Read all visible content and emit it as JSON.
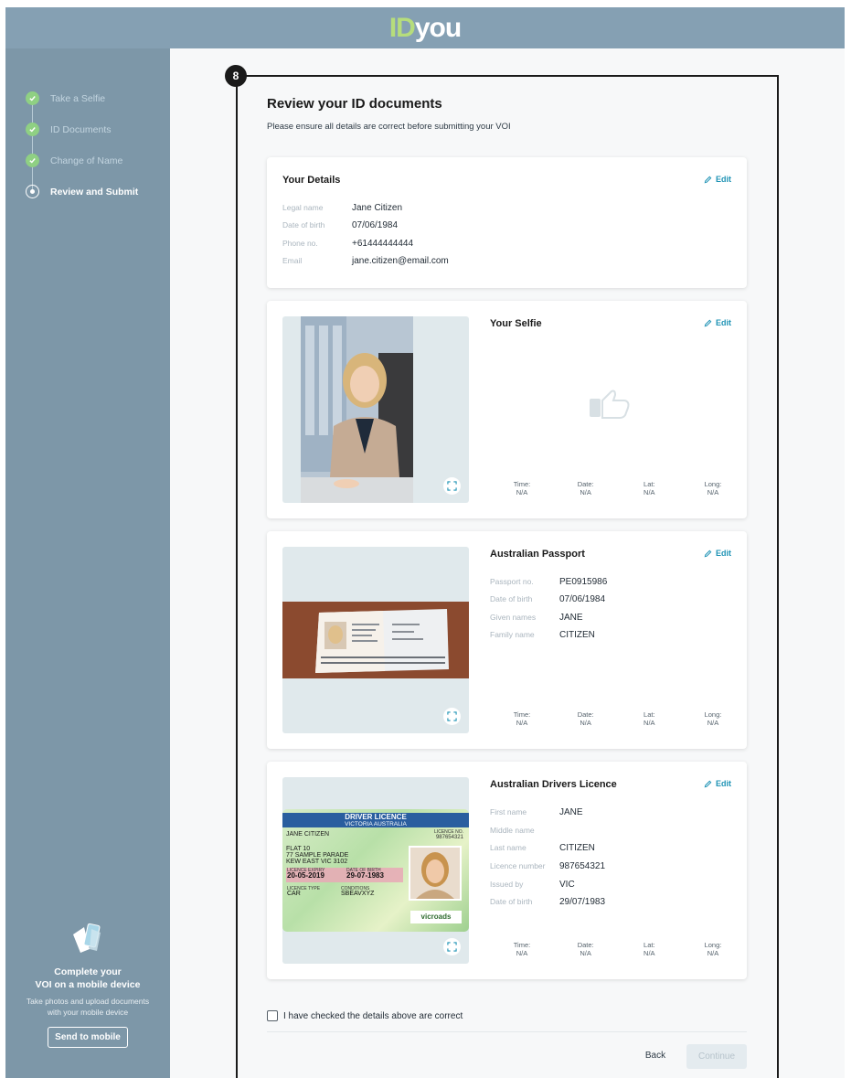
{
  "header": {
    "logo_id": "ID",
    "logo_you": "you"
  },
  "sidebar": {
    "steps": [
      {
        "label": "Take a Selfie",
        "status": "done"
      },
      {
        "label": "ID Documents",
        "status": "done"
      },
      {
        "label": "Change of Name",
        "status": "done"
      },
      {
        "label": "Review and Submit",
        "status": "active"
      }
    ],
    "mobile": {
      "title_line1": "Complete your",
      "title_line2": "VOI on a mobile device",
      "description": "Take photos and upload documents with your mobile device",
      "button": "Send to mobile"
    }
  },
  "main": {
    "badge": "8",
    "title": "Review your ID documents",
    "subtitle": "Please ensure all details are correct before submitting your VOI",
    "edit_label": "Edit",
    "details": {
      "title": "Your Details",
      "rows": [
        {
          "label": "Legal name",
          "value": "Jane Citizen"
        },
        {
          "label": "Date of birth",
          "value": "07/06/1984"
        },
        {
          "label": "Phone no.",
          "value": "+61444444444"
        },
        {
          "label": "Email",
          "value": "jane.citizen@email.com"
        }
      ]
    },
    "meta_labels": [
      "Time:",
      "Date:",
      "Lat:",
      "Long:"
    ],
    "meta_value": "N/A",
    "selfie": {
      "title": "Your Selfie"
    },
    "passport": {
      "title": "Australian Passport",
      "rows": [
        {
          "label": "Passport no.",
          "value": "PE0915986"
        },
        {
          "label": "Date of birth",
          "value": "07/06/1984"
        },
        {
          "label": "Given names",
          "value": "JANE"
        },
        {
          "label": "Family name",
          "value": "CITIZEN"
        }
      ]
    },
    "licence": {
      "title": "Australian Drivers Licence",
      "rows": [
        {
          "label": "First name",
          "value": "JANE"
        },
        {
          "label": "Middle name",
          "value": ""
        },
        {
          "label": "Last name",
          "value": "CITIZEN"
        },
        {
          "label": "Licence number",
          "value": "987654321"
        },
        {
          "label": "Issued by",
          "value": "VIC"
        },
        {
          "label": "Date of birth",
          "value": "29/07/1983"
        }
      ],
      "card_text": {
        "heading": "DRIVER LICENCE",
        "subheading": "VICTORIA AUSTRALIA",
        "name": "JANE CITIZEN",
        "licence_no_label": "LICENCE NO.",
        "licence_no": "987654321",
        "address1": "FLAT 10",
        "address2": "77 SAMPLE PARADE",
        "address3": "KEW EAST VIC 3102",
        "expiry_label": "LICENCE EXPIRY",
        "expiry": "20-05-2019",
        "dob_label": "DATE OF BIRTH",
        "dob": "29-07-1983",
        "type_label": "LICENCE TYPE",
        "type": "CAR",
        "conditions_label": "CONDITIONS",
        "conditions": "SBEAVXYZ",
        "brand": "vicroads"
      }
    },
    "confirm_label": "I have checked the details above are correct",
    "back_label": "Back",
    "continue_label": "Continue"
  }
}
